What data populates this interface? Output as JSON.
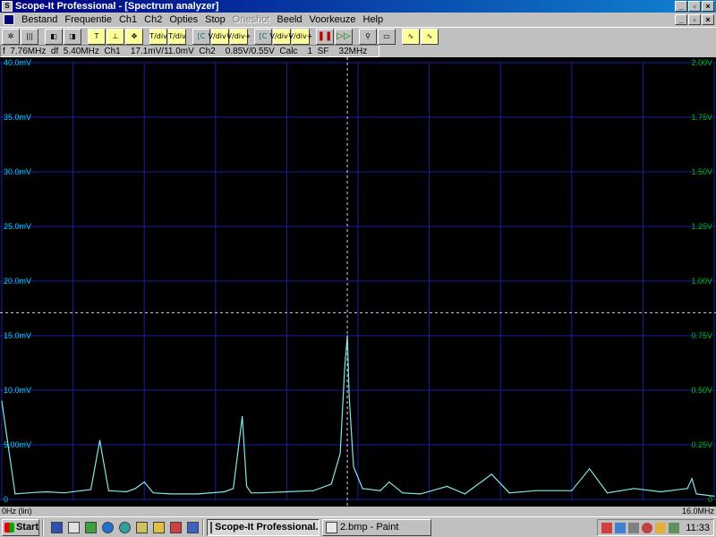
{
  "window": {
    "title": "Scope-It Professional - [Spectrum analyzer]"
  },
  "menu": {
    "items": [
      "Bestand",
      "Frequentie",
      "Ch1",
      "Ch2",
      "Opties",
      "Stop",
      "Oneshot",
      "Beeld",
      "Voorkeuze",
      "Help"
    ],
    "disabled": [
      "Oneshot"
    ]
  },
  "toolbar": {
    "buttons": [
      {
        "icon": "gear-icon",
        "glyph": "✲"
      },
      {
        "icon": "bars-icon",
        "glyph": "|||"
      },
      {
        "icon": "channel-left-icon",
        "glyph": "◧"
      },
      {
        "icon": "channel-right-icon",
        "glyph": "◨"
      },
      {
        "icon": "time-cursor-icon",
        "glyph": "T"
      },
      {
        "icon": "dot-cursor-icon",
        "glyph": "⊥"
      },
      {
        "icon": "crosshair-icon",
        "glyph": "✥"
      },
      {
        "icon": "time-div-up-icon",
        "glyph": "T/div"
      },
      {
        "icon": "time-div-down-icon",
        "glyph": "T/div"
      },
      {
        "icon": "ch1-marker-icon",
        "glyph": "[C"
      },
      {
        "icon": "volt-div-down-icon",
        "glyph": "V/div−"
      },
      {
        "icon": "volt-div-up-icon",
        "glyph": "V/div+"
      },
      {
        "icon": "ch2-marker-icon",
        "glyph": "[C"
      },
      {
        "icon": "volt-div-down-2-icon",
        "glyph": "V/div−"
      },
      {
        "icon": "volt-div-up-2-icon",
        "glyph": "V/div+"
      },
      {
        "icon": "pause-icon",
        "glyph": "❚❚"
      },
      {
        "icon": "play-icon",
        "glyph": "▷▷"
      },
      {
        "icon": "magnify-icon",
        "glyph": "⚲"
      },
      {
        "icon": "grid-icon",
        "glyph": "▭"
      },
      {
        "icon": "wave-1-icon",
        "glyph": "∿"
      },
      {
        "icon": "wave-2-icon",
        "glyph": "∿"
      }
    ]
  },
  "readout": {
    "text": "f  7.76MHz  df  5.40MHz  Ch1    17.1mV/11.0mV  Ch2    0.85V/0.55V  Calc    1  SF    32MHz"
  },
  "scope": {
    "left_labels": [
      "40.0mV",
      "35.0mV",
      "30.0mV",
      "25.0mV",
      "20.0mV",
      "15.0mV",
      "10.0mV",
      "5.00mV",
      "0"
    ],
    "right_labels": [
      "2.00V",
      "1.75V",
      "1.50V",
      "1.25V",
      "1.00V",
      "0.75V",
      "0.50V",
      "0.25V",
      "0"
    ],
    "x_start_label": "0Hz (lin)",
    "x_end_label": "16.0MHz",
    "colors": {
      "trace": "#7fe8e8",
      "grid": "#1820a0",
      "cursor": "#d0d0ff",
      "left_axis": "#00d0ff",
      "right_axis": "#00c000"
    }
  },
  "chart_data": {
    "type": "line",
    "title": "",
    "xlabel": "0Hz (lin)",
    "ylabel": "",
    "xlim": [
      0,
      16.0
    ],
    "ylim": [
      0,
      40.0
    ],
    "x": [
      0,
      0.3,
      0.6,
      1.0,
      1.4,
      1.8,
      2.0,
      2.2,
      2.4,
      2.8,
      3.0,
      3.2,
      3.4,
      3.8,
      4.4,
      5.0,
      5.2,
      5.4,
      5.5,
      5.6,
      5.8,
      6.4,
      7.0,
      7.4,
      7.6,
      7.7,
      7.76,
      7.8,
      7.9,
      8.1,
      8.5,
      8.7,
      9.0,
      9.4,
      10.0,
      10.4,
      11.0,
      11.4,
      12.0,
      12.8,
      13.2,
      13.6,
      14.2,
      14.8,
      15.4,
      15.5,
      15.6,
      16.0
    ],
    "y": [
      9.0,
      0.5,
      0.6,
      0.7,
      0.6,
      0.8,
      0.9,
      5.4,
      0.8,
      0.7,
      1.0,
      1.6,
      0.6,
      0.5,
      0.5,
      0.7,
      1.0,
      7.6,
      1.2,
      0.6,
      0.6,
      0.7,
      0.8,
      1.4,
      4.2,
      12.0,
      15.0,
      9.5,
      3.0,
      1.0,
      0.8,
      1.6,
      0.6,
      0.5,
      1.2,
      0.5,
      2.3,
      0.6,
      0.8,
      0.8,
      2.8,
      0.6,
      1.0,
      0.7,
      1.0,
      1.9,
      0.5,
      0.3
    ]
  },
  "taskbar": {
    "start_label": "Start",
    "tasks": [
      {
        "label": "Scope-It Professional...",
        "active": true
      },
      {
        "label": "2.bmp - Paint",
        "active": false
      }
    ],
    "clock": "11:33"
  }
}
